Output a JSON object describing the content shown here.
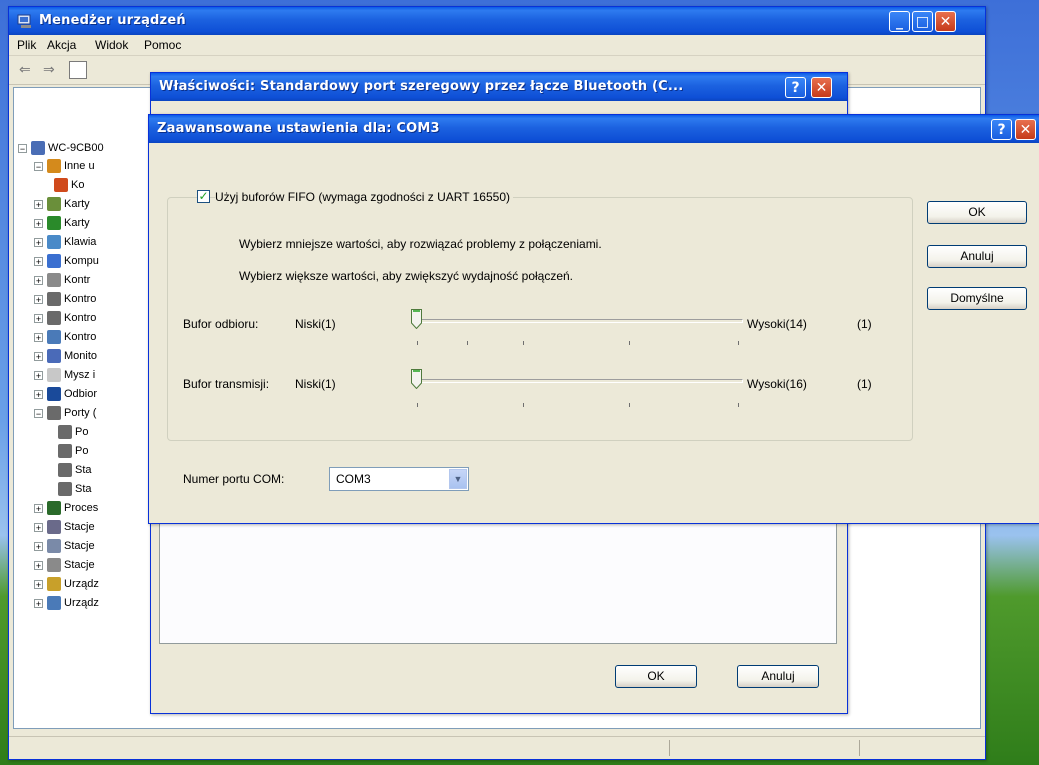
{
  "device_manager": {
    "title": "Menedżer urządzeń",
    "menu": [
      "Plik",
      "Akcja",
      "Widok",
      "Pomoc"
    ],
    "tree": {
      "root": "WC-9CB00",
      "items": [
        "Inne u",
        "Ko",
        "Karty",
        "Karty",
        "Klawia",
        "Kompu",
        "Kontr",
        "Kontro",
        "Kontro",
        "Kontro",
        "Monito",
        "Mysz i",
        "Odbior",
        "Porty (",
        "Po",
        "Po",
        "Sta",
        "Sta",
        "Proces",
        "Stacje",
        "Stacje",
        "Stacje",
        "Urządz",
        "Urządz"
      ]
    }
  },
  "properties_dialog": {
    "title": "Właściwości: Standardowy port szeregowy przez łącze Bluetooth (C...",
    "help_label": "?",
    "close_label": "✕",
    "ok_label": "OK",
    "cancel_label": "Anuluj"
  },
  "advanced_dialog": {
    "title": "Zaawansowane ustawienia dla: COM3",
    "help_label": "?",
    "close_label": "✕",
    "fifo_checkbox_label": "Użyj buforów FIFO (wymaga zgodności z UART 16550)",
    "fifo_checked": true,
    "hint_low": "Wybierz mniejsze wartości, aby rozwiązać problemy z połączeniami.",
    "hint_high": "Wybierz większe wartości, aby zwiększyć wydajność połączeń.",
    "receive": {
      "label": "Bufor odbioru:",
      "low": "Niski(1)",
      "high": "Wysoki(14)",
      "current": "(1)",
      "level": 0
    },
    "transmit": {
      "label": "Bufor transmisji:",
      "low": "Niski(1)",
      "high": "Wysoki(16)",
      "current": "(1)",
      "level": 0
    },
    "com_port_label": "Numer portu COM:",
    "com_port_value": "COM3",
    "ok_label": "OK",
    "cancel_label": "Anuluj",
    "defaults_label": "Domyślne"
  },
  "colors": {
    "titlebar": "#0a5ae8",
    "close_button": "#c53a1a",
    "dialog_bg": "#ece9d8"
  }
}
